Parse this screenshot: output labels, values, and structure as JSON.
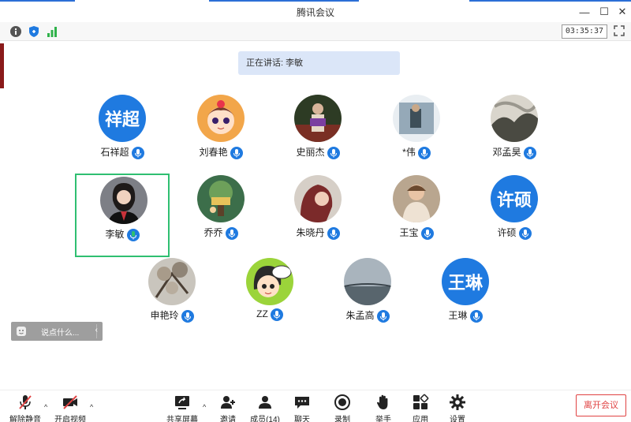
{
  "window": {
    "title": "腾讯会议"
  },
  "toolbar": {
    "clock": "03:35:37"
  },
  "speaking": {
    "label": "正在讲话: 李敏"
  },
  "participants": [
    {
      "name": "石祥超",
      "avatar_text": "祥超",
      "avatar": "blue"
    },
    {
      "name": "刘春艳",
      "avatar_text": "",
      "avatar": "cartoon-girl"
    },
    {
      "name": "史丽杰",
      "avatar_text": "",
      "avatar": "photo-bench"
    },
    {
      "name": "*伟",
      "avatar_text": "",
      "avatar": "photo-square"
    },
    {
      "name": "邓孟昊",
      "avatar_text": "",
      "avatar": "photo-snow"
    },
    {
      "name": "李敏",
      "avatar_text": "",
      "avatar": "photo-woman"
    },
    {
      "name": "乔乔",
      "avatar_text": "",
      "avatar": "photo-tree"
    },
    {
      "name": "朱晓丹",
      "avatar_text": "",
      "avatar": "photo-red"
    },
    {
      "name": "王宝",
      "avatar_text": "",
      "avatar": "photo-child"
    },
    {
      "name": "许硕",
      "avatar_text": "许硕",
      "avatar": "blue"
    },
    {
      "name": "申艳玲",
      "avatar_text": "",
      "avatar": "photo-blossom"
    },
    {
      "name": "ZZ",
      "avatar_text": "",
      "avatar": "cartoon-zz"
    },
    {
      "name": "朱孟高",
      "avatar_text": "",
      "avatar": "photo-sky"
    },
    {
      "name": "王琳",
      "avatar_text": "王琳",
      "avatar": "blue"
    }
  ],
  "chat": {
    "placeholder": "说点什么..."
  },
  "bottom": {
    "unmute": "解除静音",
    "video": "开启视频",
    "share": "共享屏幕",
    "invite": "邀请",
    "members": "成员(14)",
    "chat": "聊天",
    "record": "录制",
    "raise_hand": "举手",
    "apps": "应用",
    "settings": "设置",
    "leave": "离开会议"
  },
  "colors": {
    "accent": "#1f7ae0",
    "active_border": "#2fbf71",
    "leave": "#e04343"
  }
}
